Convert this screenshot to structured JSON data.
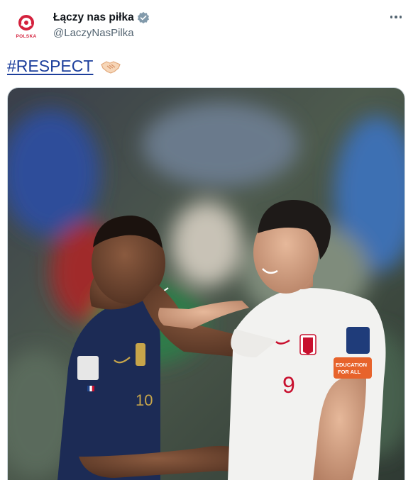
{
  "author": {
    "display_name": "Łączy nas piłka",
    "handle": "@LaczyNasPilka",
    "avatar_text": "POLSKA",
    "verified_icon": "verified-badge-icon"
  },
  "tweet": {
    "hashtag": "#RESPECT",
    "emoji": "handshake-icon"
  },
  "media": {
    "icon": "photo",
    "left_player_shirt_number": "10",
    "right_player_shirt_number": "9",
    "armband_text_1": "EDUCATION",
    "armband_text_2": "FOR ALL"
  },
  "colors": {
    "hashtag": "#1d3f9c",
    "handle": "#536471",
    "verified": "#829aab",
    "brand_red": "#d4213d"
  }
}
